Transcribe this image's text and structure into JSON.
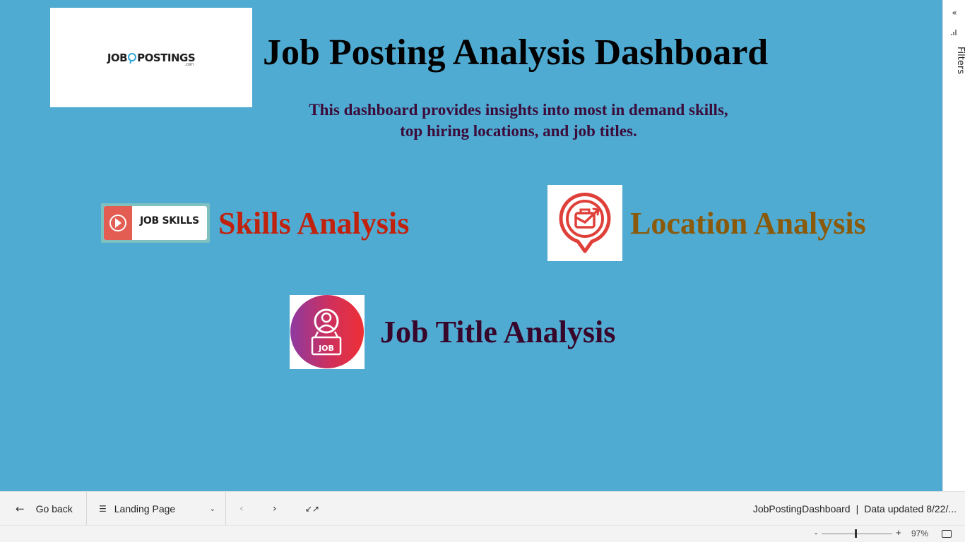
{
  "colors": {
    "canvas_bg": "#50abd2",
    "title": "#000000",
    "subtitle": "#3b0c3a",
    "skills": "#c0220e",
    "location": "#8a5a0a",
    "jobtitle": "#38062a"
  },
  "logo": {
    "text_left": "JOB",
    "text_right": "POSTINGS",
    "sub": ".com"
  },
  "header": {
    "title": "Job Posting Analysis Dashboard",
    "subtitle": "This dashboard provides insights into most in demand skills, top hiring locations, and job titles."
  },
  "tiles": {
    "skills": {
      "badge_text": "JOB SKILLS",
      "label": "Skills Analysis",
      "icon": "job-skills-badge-icon"
    },
    "location": {
      "label": "Location Analysis",
      "icon": "location-briefcase-pin-icon"
    },
    "jobtitle": {
      "badge_text": "JOB",
      "label": "Job Title Analysis",
      "icon": "job-person-icon"
    }
  },
  "filters": {
    "label": "Filters",
    "collapse_icon": "double-chevron-left-icon"
  },
  "bottombar": {
    "go_back": "Go back",
    "page": "Landing Page",
    "report_name": "JobPostingDashboard",
    "divider": "|",
    "data_updated": "Data updated 8/22/..."
  },
  "status": {
    "zoom_minus": "-",
    "zoom_plus": "+",
    "zoom": "97%",
    "zoom_fraction": 0.47
  }
}
